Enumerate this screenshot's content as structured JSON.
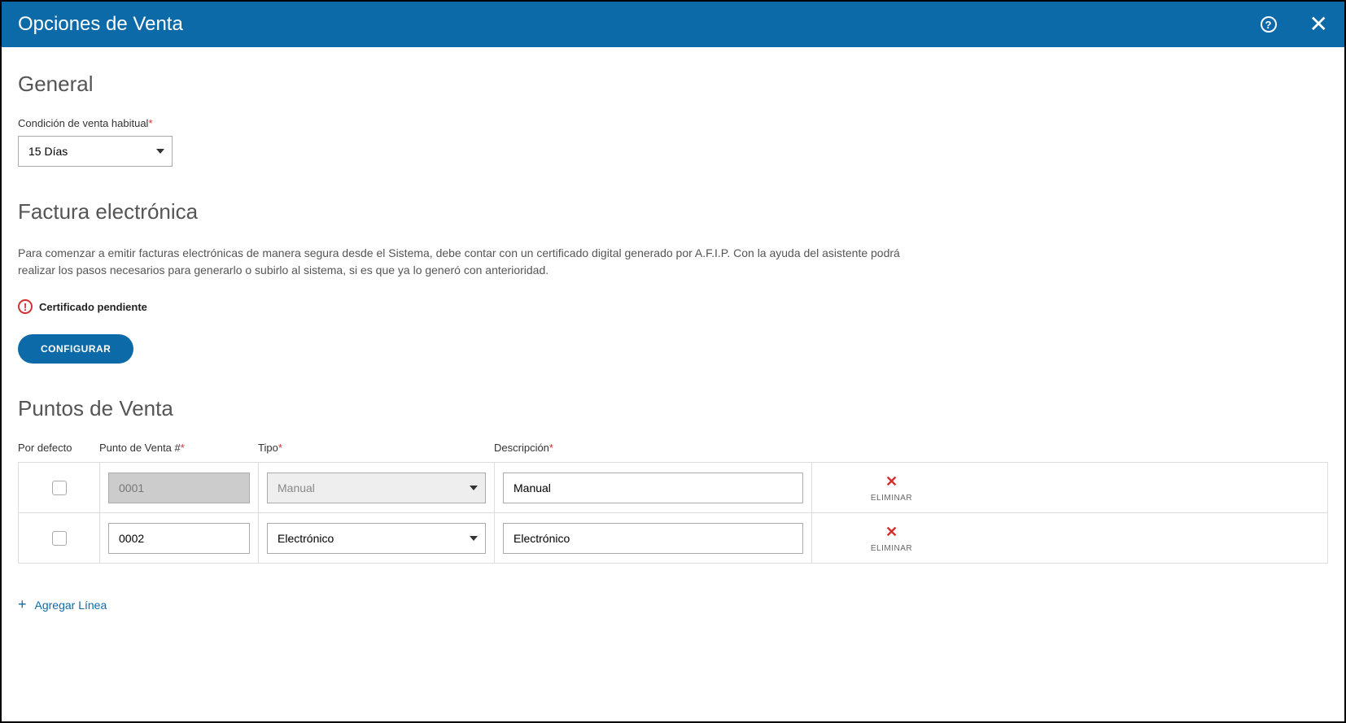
{
  "header": {
    "title": "Opciones de Venta"
  },
  "general": {
    "title": "General",
    "condition_label": "Condición de venta habitual",
    "condition_value": "15 Días"
  },
  "invoice": {
    "title": "Factura electrónica",
    "description": "Para comenzar a emitir facturas electrónicas de manera segura desde el Sistema, debe contar con un certificado digital generado por A.F.I.P. Con la ayuda del asistente podrá realizar los pasos necesarios para generarlo o subirlo al sistema, si es que ya lo generó con anterioridad.",
    "warning": "Certificado pendiente",
    "configure_button": "CONFIGURAR"
  },
  "pos": {
    "title": "Puntos de Venta",
    "headers": {
      "default": "Por defecto",
      "number": "Punto de Venta #",
      "type": "Tipo",
      "description": "Descripción"
    },
    "rows": [
      {
        "number": "0001",
        "type": "Manual",
        "description": "Manual",
        "delete": "ELIMINAR",
        "disabled": true
      },
      {
        "number": "0002",
        "type": "Electrónico",
        "description": "Electrónico",
        "delete": "ELIMINAR",
        "disabled": false
      }
    ],
    "add_line": "Agregar Línea"
  }
}
